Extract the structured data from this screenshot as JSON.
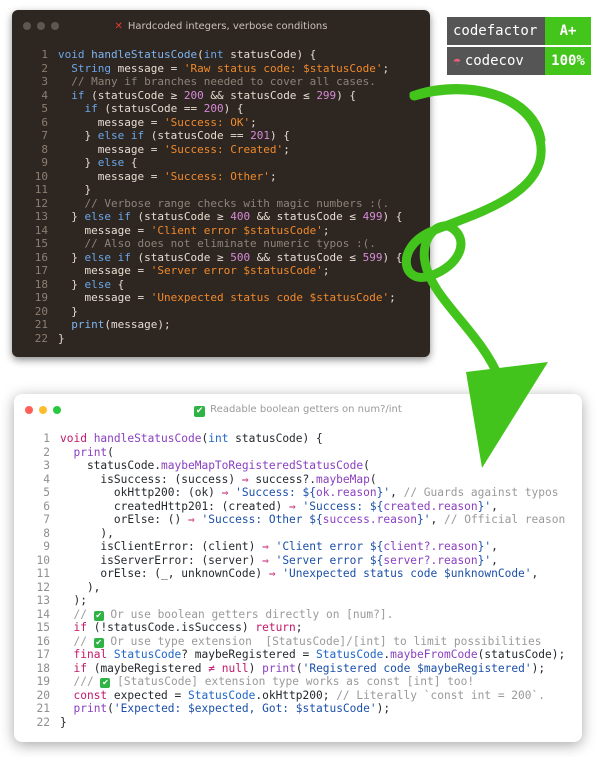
{
  "top_window": {
    "title": "Hardcoded integers, verbose conditions",
    "title_icon": "cross-mark-icon",
    "lines": [
      [
        [
          "kw",
          "void "
        ],
        [
          "fn",
          "handleStatusCode"
        ],
        [
          "pl",
          "("
        ],
        [
          "ty",
          "int"
        ],
        [
          "pl",
          " statusCode) {"
        ]
      ],
      [
        [
          "pl",
          "  "
        ],
        [
          "ty",
          "String"
        ],
        [
          "pl",
          " message = "
        ],
        [
          "str",
          "'Raw status code: $statusCode'"
        ],
        [
          "pl",
          ";"
        ]
      ],
      [
        [
          "cm",
          "  // Many if branches needed to cover all cases."
        ]
      ],
      [
        [
          "pl",
          "  "
        ],
        [
          "kw",
          "if"
        ],
        [
          "pl",
          " (statusCode "
        ],
        [
          "op",
          "≥"
        ],
        [
          "pl",
          " "
        ],
        [
          "num",
          "200"
        ],
        [
          "pl",
          " && statusCode "
        ],
        [
          "op",
          "≤"
        ],
        [
          "pl",
          " "
        ],
        [
          "num",
          "299"
        ],
        [
          "pl",
          ") {"
        ]
      ],
      [
        [
          "pl",
          "    "
        ],
        [
          "kw",
          "if"
        ],
        [
          "pl",
          " (statusCode "
        ],
        [
          "op",
          "=="
        ],
        [
          "pl",
          " "
        ],
        [
          "num",
          "200"
        ],
        [
          "pl",
          ") {"
        ]
      ],
      [
        [
          "pl",
          "      message = "
        ],
        [
          "str",
          "'Success: OK'"
        ],
        [
          "pl",
          ";"
        ]
      ],
      [
        [
          "pl",
          "    } "
        ],
        [
          "kw",
          "else if"
        ],
        [
          "pl",
          " (statusCode "
        ],
        [
          "op",
          "=="
        ],
        [
          "pl",
          " "
        ],
        [
          "num",
          "201"
        ],
        [
          "pl",
          ") {"
        ]
      ],
      [
        [
          "pl",
          "      message = "
        ],
        [
          "str",
          "'Success: Created'"
        ],
        [
          "pl",
          ";"
        ]
      ],
      [
        [
          "pl",
          "    } "
        ],
        [
          "kw",
          "else"
        ],
        [
          "pl",
          " {"
        ]
      ],
      [
        [
          "pl",
          "      message = "
        ],
        [
          "str",
          "'Success: Other'"
        ],
        [
          "pl",
          ";"
        ]
      ],
      [
        [
          "pl",
          "    }"
        ]
      ],
      [
        [
          "cm",
          "    // Verbose range checks with magic numbers :(."
        ]
      ],
      [
        [
          "pl",
          "  } "
        ],
        [
          "kw",
          "else if"
        ],
        [
          "pl",
          " (statusCode "
        ],
        [
          "op",
          "≥"
        ],
        [
          "pl",
          " "
        ],
        [
          "num",
          "400"
        ],
        [
          "pl",
          " && statusCode "
        ],
        [
          "op",
          "≤"
        ],
        [
          "pl",
          " "
        ],
        [
          "num",
          "499"
        ],
        [
          "pl",
          ") {"
        ]
      ],
      [
        [
          "pl",
          "    message = "
        ],
        [
          "str",
          "'Client error $statusCode'"
        ],
        [
          "pl",
          ";"
        ]
      ],
      [
        [
          "cm",
          "    // Also does not eliminate numeric typos :(."
        ]
      ],
      [
        [
          "pl",
          "  } "
        ],
        [
          "kw",
          "else if"
        ],
        [
          "pl",
          " (statusCode "
        ],
        [
          "op",
          "≥"
        ],
        [
          "pl",
          " "
        ],
        [
          "num",
          "500"
        ],
        [
          "pl",
          " && statusCode "
        ],
        [
          "op",
          "≤"
        ],
        [
          "pl",
          " "
        ],
        [
          "num",
          "599"
        ],
        [
          "pl",
          ") {"
        ]
      ],
      [
        [
          "pl",
          "    message = "
        ],
        [
          "str",
          "'Server error $statusCode'"
        ],
        [
          "pl",
          ";"
        ]
      ],
      [
        [
          "pl",
          "  } "
        ],
        [
          "kw",
          "else"
        ],
        [
          "pl",
          " {"
        ]
      ],
      [
        [
          "pl",
          "    message = "
        ],
        [
          "str",
          "'Unexpected status code $statusCode'"
        ],
        [
          "pl",
          ";"
        ]
      ],
      [
        [
          "pl",
          "  }"
        ]
      ],
      [
        [
          "pl",
          "  "
        ],
        [
          "fn",
          "print"
        ],
        [
          "pl",
          "(message);"
        ]
      ],
      [
        [
          "pl",
          "}"
        ]
      ]
    ]
  },
  "bottom_window": {
    "title": "Readable boolean getters on num?/int",
    "title_icon": "check-mark-icon",
    "lines": [
      [
        [
          "kw",
          "void "
        ],
        [
          "fn",
          "handleStatusCode"
        ],
        [
          "pl",
          "("
        ],
        [
          "ty",
          "int"
        ],
        [
          "pl",
          " statusCode) {"
        ]
      ],
      [
        [
          "pl",
          "  "
        ],
        [
          "fn",
          "print"
        ],
        [
          "pl",
          "("
        ]
      ],
      [
        [
          "pl",
          "    statusCode."
        ],
        [
          "fn",
          "maybeMapToRegisteredStatusCode"
        ],
        [
          "pl",
          "("
        ]
      ],
      [
        [
          "pl",
          "      isSuccess: (success) "
        ],
        [
          "op",
          "⇒"
        ],
        [
          "pl",
          " success?."
        ],
        [
          "fn",
          "maybeMap"
        ],
        [
          "pl",
          "("
        ]
      ],
      [
        [
          "pl",
          "        okHttp200: (ok) "
        ],
        [
          "op",
          "⇒"
        ],
        [
          "pl",
          " "
        ],
        [
          "str",
          "'Success: ${"
        ],
        [
          "prop",
          "ok.reason"
        ],
        [
          "str",
          "}'"
        ],
        [
          "pl",
          ", "
        ],
        [
          "cm",
          "// Guards against typos"
        ]
      ],
      [
        [
          "pl",
          "        createdHttp201: (created) "
        ],
        [
          "op",
          "⇒"
        ],
        [
          "pl",
          " "
        ],
        [
          "str",
          "'Success: ${"
        ],
        [
          "prop",
          "created.reason"
        ],
        [
          "str",
          "}'"
        ],
        [
          "pl",
          ","
        ]
      ],
      [
        [
          "pl",
          "        orElse: () "
        ],
        [
          "op",
          "⇒"
        ],
        [
          "pl",
          " "
        ],
        [
          "str",
          "'Success: Other ${"
        ],
        [
          "prop",
          "success.reason"
        ],
        [
          "str",
          "}'"
        ],
        [
          "pl",
          ", "
        ],
        [
          "cm",
          "// Official reason"
        ]
      ],
      [
        [
          "pl",
          "      ),"
        ]
      ],
      [
        [
          "pl",
          "      isClientError: (client) "
        ],
        [
          "op",
          "⇒"
        ],
        [
          "pl",
          " "
        ],
        [
          "str",
          "'Client error ${"
        ],
        [
          "prop",
          "client?.reason"
        ],
        [
          "str",
          "}'"
        ],
        [
          "pl",
          ","
        ]
      ],
      [
        [
          "pl",
          "      isServerError: (server) "
        ],
        [
          "op",
          "⇒"
        ],
        [
          "pl",
          " "
        ],
        [
          "str",
          "'Server error ${"
        ],
        [
          "prop",
          "server?.reason"
        ],
        [
          "str",
          "}'"
        ],
        [
          "pl",
          ","
        ]
      ],
      [
        [
          "pl",
          "      orElse: (_, unknownCode) "
        ],
        [
          "op",
          "⇒"
        ],
        [
          "pl",
          " "
        ],
        [
          "str",
          "'Unexpected status code $unknownCode'"
        ],
        [
          "pl",
          ","
        ]
      ],
      [
        [
          "pl",
          "    ),"
        ]
      ],
      [
        [
          "pl",
          "  );"
        ]
      ],
      [
        [
          "cm",
          "  // "
        ],
        [
          "check",
          "✔"
        ],
        [
          "cm",
          " Or use boolean getters directly on [num?]."
        ]
      ],
      [
        [
          "pl",
          "  "
        ],
        [
          "kw",
          "if"
        ],
        [
          "pl",
          " (!statusCode.isSuccess) "
        ],
        [
          "kw",
          "return"
        ],
        [
          "pl",
          ";"
        ]
      ],
      [
        [
          "cm",
          "  // "
        ],
        [
          "check",
          "✔"
        ],
        [
          "cm",
          " Or use type extension  [StatusCode]/[int] to limit possibilities"
        ]
      ],
      [
        [
          "pl",
          "  "
        ],
        [
          "kw",
          "final "
        ],
        [
          "ty",
          "StatusCode"
        ],
        [
          "pl",
          "? maybeRegistered = "
        ],
        [
          "ty",
          "StatusCode"
        ],
        [
          "pl",
          "."
        ],
        [
          "fn",
          "maybeFromCode"
        ],
        [
          "pl",
          "(statusCode);"
        ]
      ],
      [
        [
          "pl",
          "  "
        ],
        [
          "kw",
          "if"
        ],
        [
          "pl",
          " (maybeRegistered "
        ],
        [
          "op",
          "≠"
        ],
        [
          "pl",
          " "
        ],
        [
          "kw",
          "null"
        ],
        [
          "pl",
          ") "
        ],
        [
          "fn",
          "print"
        ],
        [
          "pl",
          "("
        ],
        [
          "str",
          "'Registered code $maybeRegistered'"
        ],
        [
          "pl",
          ");"
        ]
      ],
      [
        [
          "cm",
          "  /// "
        ],
        [
          "check",
          "✔"
        ],
        [
          "cm",
          " [StatusCode] extension type works as const [int] too!"
        ]
      ],
      [
        [
          "pl",
          "  "
        ],
        [
          "kw",
          "const"
        ],
        [
          "pl",
          " expected = "
        ],
        [
          "ty",
          "StatusCode"
        ],
        [
          "pl",
          ".okHttp200; "
        ],
        [
          "cm",
          "// Literally `const int = 200`."
        ]
      ],
      [
        [
          "pl",
          "  "
        ],
        [
          "fn",
          "print"
        ],
        [
          "pl",
          "("
        ],
        [
          "str",
          "'Expected: $expected, Got: $statusCode'"
        ],
        [
          "pl",
          ");"
        ]
      ],
      [
        [
          "pl",
          "}"
        ]
      ]
    ]
  },
  "badges": {
    "codefactor": {
      "label": "codefactor",
      "value": "A+",
      "color": "#44c51b"
    },
    "codecov": {
      "label": "codecov",
      "value": "100%",
      "icon": "umbrella-icon",
      "color": "#44c51b"
    }
  },
  "arrow": {
    "color": "#43c41c",
    "icon": "curved-arrow-icon"
  }
}
